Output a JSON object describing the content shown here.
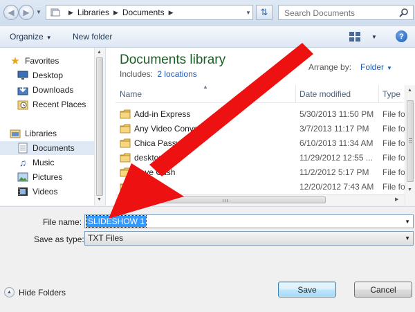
{
  "address": {
    "crumbs": [
      "Libraries",
      "Documents"
    ],
    "search_placeholder": "Search Documents"
  },
  "toolbar": {
    "organize_label": "Organize",
    "new_folder_label": "New folder",
    "help_label": "?"
  },
  "nav": {
    "favorites_label": "Favorites",
    "favorites": [
      "Desktop",
      "Downloads",
      "Recent Places"
    ],
    "libraries_label": "Libraries",
    "libraries": [
      "Documents",
      "Music",
      "Pictures",
      "Videos"
    ]
  },
  "content": {
    "title": "Documents library",
    "includes_label": "Includes:",
    "includes_link": "2 locations",
    "arrange_label": "Arrange by:",
    "arrange_value": "Folder",
    "columns": {
      "name": "Name",
      "date": "Date modified",
      "type": "Type"
    },
    "rows": [
      {
        "name": "Add-in Express",
        "date": "5/30/2013 11:50 PM",
        "type": "File fol"
      },
      {
        "name": "Any Video Converter",
        "date": "3/7/2013 11:17 PM",
        "type": "File fol"
      },
      {
        "name": "Chica Passwords",
        "date": "6/10/2013 11:34 AM",
        "type": "File fol"
      },
      {
        "name": "desktop files",
        "date": "11/29/2012 12:55 ...",
        "type": "File fol"
      },
      {
        "name": "Dave Cash",
        "date": "11/2/2012 5:17 PM",
        "type": "File fol"
      },
      {
        "name": "Player",
        "date": "12/20/2012 7:43 AM",
        "type": "File fol"
      }
    ]
  },
  "save": {
    "filename_label": "File name:",
    "filename_value": "SLIDESHOW 1",
    "savetype_label": "Save as type:",
    "savetype_value": "TXT Files",
    "hide_folders_label": "Hide Folders",
    "save_button": "Save",
    "cancel_button": "Cancel"
  },
  "colors": {
    "library_title": "#1a5d23",
    "link": "#1b5bb5",
    "selection": "#3399ff",
    "annotation_arrow": "#ee1111"
  }
}
